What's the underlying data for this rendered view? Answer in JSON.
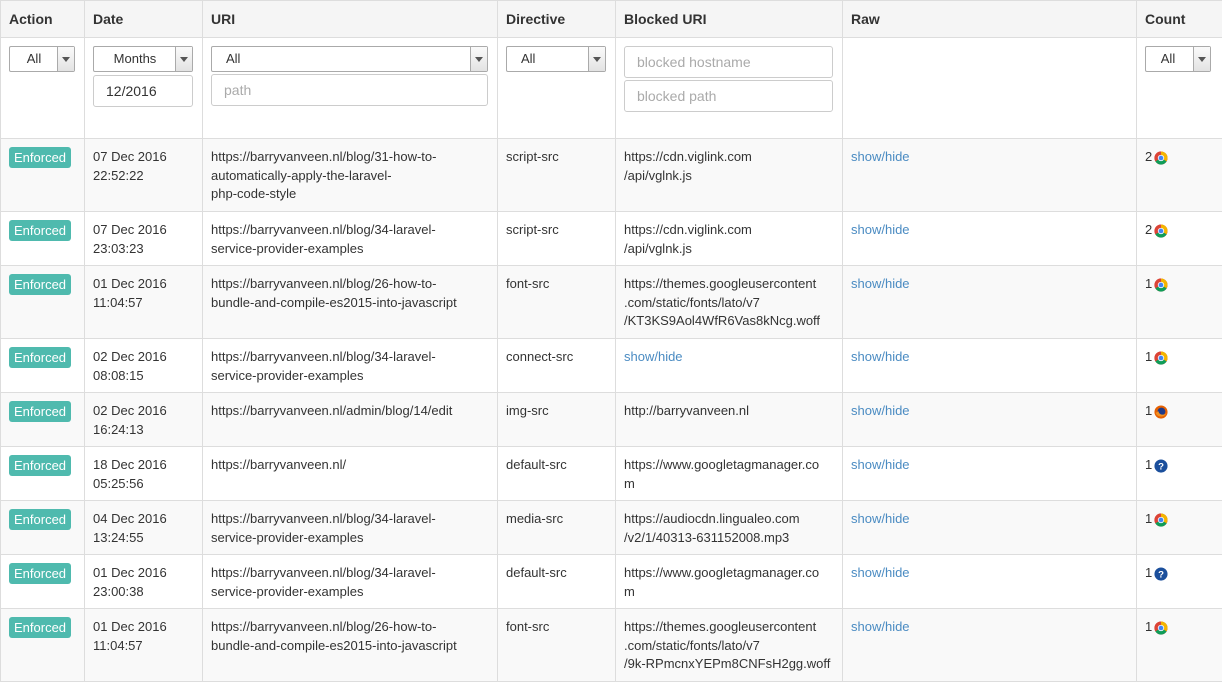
{
  "columns": [
    "Action",
    "Date",
    "URI",
    "Directive",
    "Blocked URI",
    "Raw",
    "Count"
  ],
  "filters": {
    "action": "All",
    "date_period": "Months",
    "date_value": "12/2016",
    "uri": "All",
    "uri_path_placeholder": "path",
    "directive": "All",
    "blocked_hostname_placeholder": "blocked hostname",
    "blocked_path_placeholder": "blocked path",
    "count": "All"
  },
  "rows": [
    {
      "action": "Enforced",
      "date": "07 Dec 2016",
      "time": "22:52:22",
      "uri": [
        "https://barryvanveen.nl/blog/31-how-to-",
        "automatically-apply-the-laravel-",
        "php-code-style"
      ],
      "directive": "script-src",
      "blocked": [
        "https://cdn.viglink.com",
        "/api/vglnk.js"
      ],
      "raw": "show/hide",
      "count": "2",
      "browser": "chrome-icon"
    },
    {
      "action": "Enforced",
      "date": "07 Dec 2016",
      "time": "23:03:23",
      "uri": [
        "https://barryvanveen.nl/blog/34-laravel-",
        "service-provider-examples"
      ],
      "directive": "script-src",
      "blocked": [
        "https://cdn.viglink.com",
        "/api/vglnk.js"
      ],
      "raw": "show/hide",
      "count": "2",
      "browser": "chrome-icon"
    },
    {
      "action": "Enforced",
      "date": "01 Dec 2016",
      "time": "11:04:57",
      "uri": [
        "https://barryvanveen.nl/blog/26-how-to-",
        "bundle-and-compile-es2015-into-javascript"
      ],
      "directive": "font-src",
      "blocked": [
        "https://themes.googleusercontent",
        ".com/static/fonts/lato/v7",
        "/KT3KS9Aol4WfR6Vas8kNcg.woff"
      ],
      "raw": "show/hide",
      "count": "1",
      "browser": "chrome-icon"
    },
    {
      "action": "Enforced",
      "date": "02 Dec 2016",
      "time": "08:08:15",
      "uri": [
        "https://barryvanveen.nl/blog/34-laravel-",
        "service-provider-examples"
      ],
      "directive": "connect-src",
      "blocked_link": "show/hide",
      "raw": "show/hide",
      "count": "1",
      "browser": "chrome-icon"
    },
    {
      "action": "Enforced",
      "date": "02 Dec 2016",
      "time": "16:24:13",
      "uri": [
        "https://barryvanveen.nl/admin/blog/14/edit"
      ],
      "directive": "img-src",
      "blocked": [
        "http://barryvanveen.nl"
      ],
      "raw": "show/hide",
      "count": "1",
      "browser": "firefox-icon"
    },
    {
      "action": "Enforced",
      "date": "18 Dec 2016",
      "time": "05:25:56",
      "uri": [
        "https://barryvanveen.nl/"
      ],
      "directive": "default-src",
      "blocked": [
        "https://www.googletagmanager.co",
        "m"
      ],
      "raw": "show/hide",
      "count": "1",
      "browser": "unknown-browser-icon"
    },
    {
      "action": "Enforced",
      "date": "04 Dec 2016",
      "time": "13:24:55",
      "uri": [
        "https://barryvanveen.nl/blog/34-laravel-",
        "service-provider-examples"
      ],
      "directive": "media-src",
      "blocked": [
        "https://audiocdn.lingualeo.com",
        "/v2/1/40313-631152008.mp3"
      ],
      "raw": "show/hide",
      "count": "1",
      "browser": "chrome-icon"
    },
    {
      "action": "Enforced",
      "date": "01 Dec 2016",
      "time": "23:00:38",
      "uri": [
        "https://barryvanveen.nl/blog/34-laravel-",
        "service-provider-examples"
      ],
      "directive": "default-src",
      "blocked": [
        "https://www.googletagmanager.co",
        "m"
      ],
      "raw": "show/hide",
      "count": "1",
      "browser": "unknown-browser-icon"
    },
    {
      "action": "Enforced",
      "date": "01 Dec 2016",
      "time": "11:04:57",
      "uri": [
        "https://barryvanveen.nl/blog/26-how-to-",
        "bundle-and-compile-es2015-into-javascript"
      ],
      "directive": "font-src",
      "blocked": [
        "https://themes.googleusercontent",
        ".com/static/fonts/lato/v7",
        "/9k-RPmcnxYEPm8CNFsH2gg.woff"
      ],
      "raw": "show/hide",
      "count": "1",
      "browser": "chrome-icon"
    }
  ]
}
